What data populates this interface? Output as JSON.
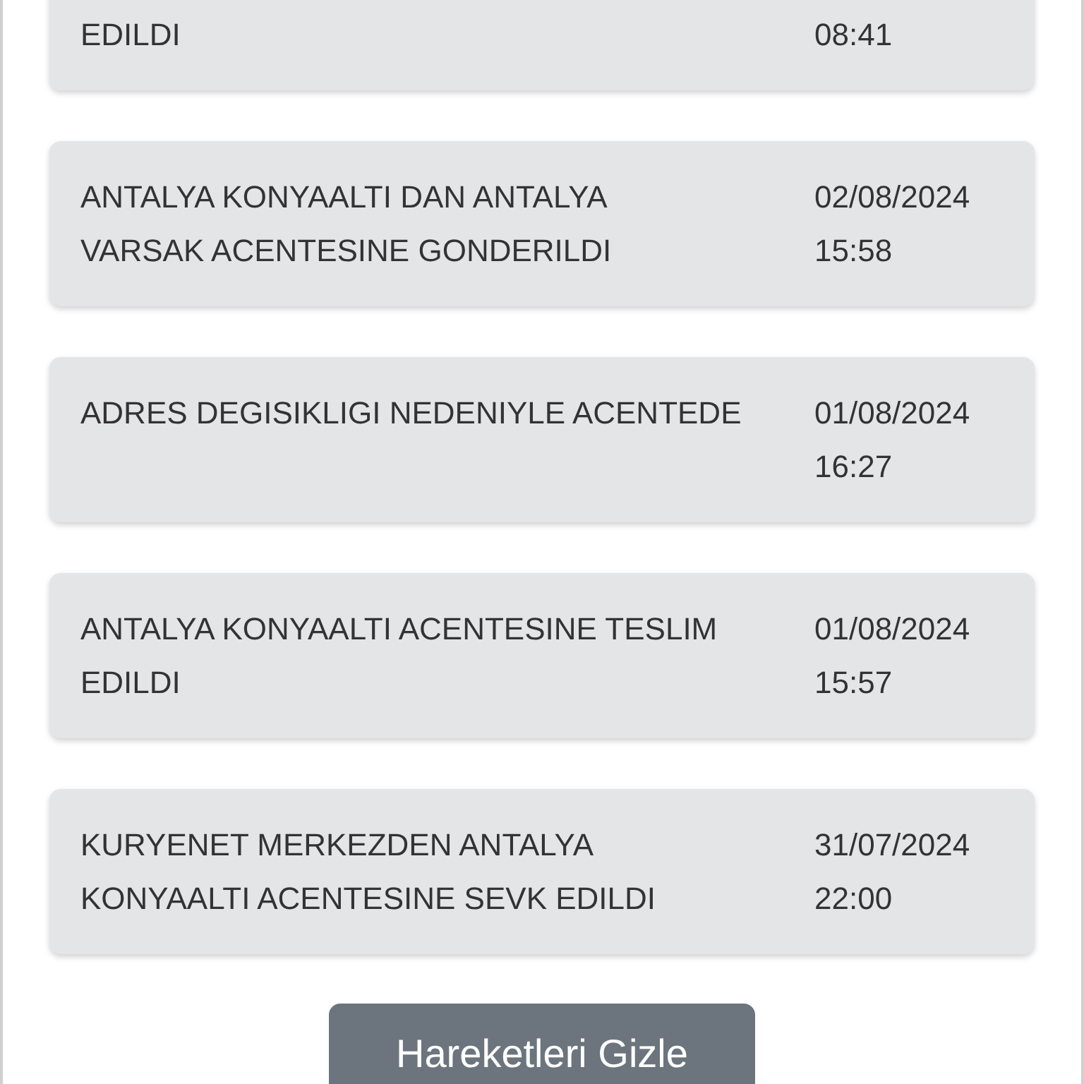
{
  "movements": [
    {
      "description": "EDILDI",
      "time": "08:41"
    },
    {
      "description": "ANTALYA KONYAALTI DAN ANTALYA\nVARSAK ACENTESINE GONDERILDI",
      "date": "02/08/2024",
      "time": "15:58"
    },
    {
      "description": "ADRES DEGISIKLIGI NEDENIYLE ACENTEDE",
      "date": "01/08/2024",
      "time": "16:27"
    },
    {
      "description": "ANTALYA KONYAALTI ACENTESINE TESLIM\nEDILDI",
      "date": "01/08/2024",
      "time": "15:57"
    },
    {
      "description": "KURYENET MERKEZDEN ANTALYA\nKONYAALTI ACENTESINE SEVK EDILDI",
      "date": "31/07/2024",
      "time": "22:00"
    }
  ],
  "hide_button": "Hareketleri Gizle"
}
